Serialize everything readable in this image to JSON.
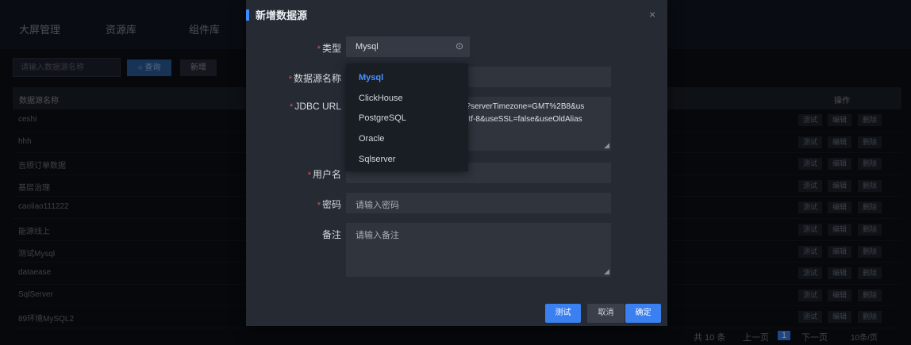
{
  "nav": {
    "items": [
      "大屏管理",
      "资源库",
      "组件库"
    ]
  },
  "toolbar": {
    "search_placeholder": "请输入数据源名称",
    "query_icon": "search-icon",
    "query_label": "查询",
    "new_label": "新增"
  },
  "table": {
    "headers": {
      "name": "数据源名称",
      "ops": "操作"
    },
    "rows": [
      "ceshi",
      "hhh",
      "吉顺订单数据",
      "基层治理",
      "caoliao111222",
      "能源线上",
      "测试Mysql",
      "dataease",
      "SqlServer",
      "89环境MySQL2"
    ],
    "ops": [
      "测试",
      "编辑",
      "删除"
    ]
  },
  "pagination": {
    "total": "共 10 条",
    "prev": "上一页",
    "page": "1",
    "next": "下一页",
    "size": "10条/页"
  },
  "dialog": {
    "title": "新增数据源",
    "close": "×",
    "type_label": "类型",
    "type_value": "Mysql",
    "name_label": "数据源名称",
    "jdbc_label": "JDBC URL",
    "jdbc_text": "ame?serverTimezone=GMT%2B8&us ng=utf-8&useSSL=false&useOldAlias",
    "user_label": "用户名",
    "pwd_label": "密码",
    "pwd_placeholder": "请输入密码",
    "remark_label": "备注",
    "remark_placeholder": "请输入备注",
    "btn_test": "测试",
    "btn_cancel": "取消",
    "btn_ok": "确定"
  },
  "dropdown": {
    "options": [
      "Mysql",
      "ClickHouse",
      "PostgreSQL",
      "Oracle",
      "Sqlserver"
    ]
  },
  "colors": {
    "accent": "#3a80f0",
    "required": "#e05252",
    "active_option": "#4b91ff"
  }
}
